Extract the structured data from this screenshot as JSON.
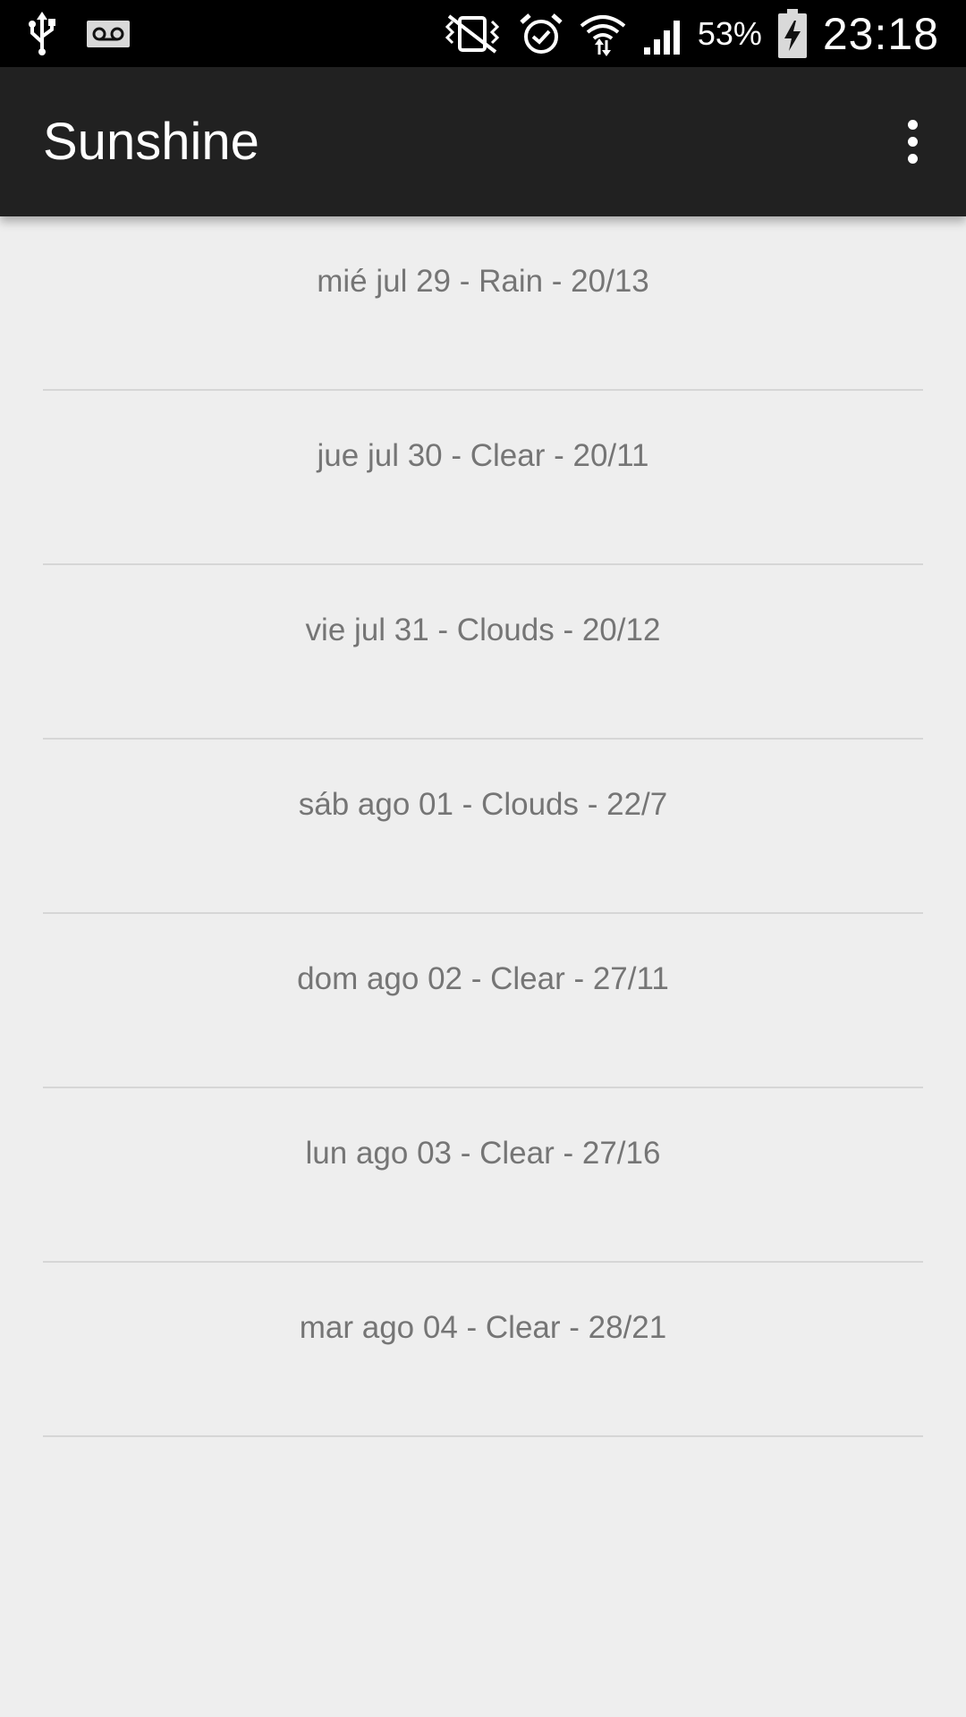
{
  "status_bar": {
    "icons": [
      "usb-icon",
      "voicemail-icon",
      "vibrate-icon",
      "alarm-icon",
      "wifi-icon",
      "signal-icon",
      "battery-charging-icon"
    ],
    "battery_percent": "53%",
    "clock": "23:18"
  },
  "app_bar": {
    "title": "Sunshine",
    "menu_icon": "more-vert-icon"
  },
  "forecast": [
    {
      "text": "mié jul 29 - Rain - 20/13"
    },
    {
      "text": "jue jul 30 - Clear - 20/11"
    },
    {
      "text": "vie jul 31 - Clouds - 20/12"
    },
    {
      "text": "sáb ago 01 - Clouds - 22/7"
    },
    {
      "text": "dom ago 02 - Clear - 27/11"
    },
    {
      "text": "lun ago 03 - Clear - 27/16"
    },
    {
      "text": "mar ago 04 - Clear - 28/21"
    }
  ],
  "colors": {
    "status_bar_bg": "#000000",
    "app_bar_bg": "#212121",
    "list_bg": "#eeeeee",
    "item_text": "#757575",
    "divider": "#d6d6d6"
  }
}
